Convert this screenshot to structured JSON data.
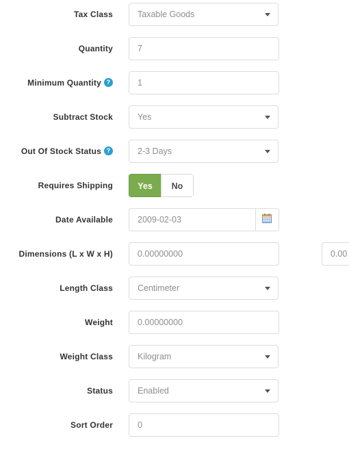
{
  "form": {
    "rows": [
      {
        "label": "Tax Class",
        "help": false,
        "type": "select",
        "value": "Taxable Goods",
        "name": "tax-class"
      },
      {
        "label": "Quantity",
        "help": false,
        "type": "input",
        "value": "7",
        "name": "quantity"
      },
      {
        "label": "Minimum Quantity",
        "help": true,
        "type": "input",
        "value": "1",
        "name": "minimum-quantity"
      },
      {
        "label": "Subtract Stock",
        "help": false,
        "type": "select",
        "value": "Yes",
        "name": "subtract-stock"
      },
      {
        "label": "Out Of Stock Status",
        "help": true,
        "type": "select",
        "value": "2-3 Days",
        "name": "out-of-stock-status"
      },
      {
        "label": "Requires Shipping",
        "help": false,
        "type": "toggle",
        "value": "Yes",
        "options": [
          "Yes",
          "No"
        ],
        "name": "requires-shipping"
      },
      {
        "label": "Date Available",
        "help": false,
        "type": "date",
        "value": "2009-02-03",
        "name": "date-available"
      },
      {
        "label": "Dimensions (L x W x H)",
        "help": false,
        "type": "dimensions",
        "value": "0.00000000",
        "value2": "0.00",
        "name": "dimensions"
      },
      {
        "label": "Length Class",
        "help": false,
        "type": "select",
        "value": "Centimeter",
        "name": "length-class"
      },
      {
        "label": "Weight",
        "help": false,
        "type": "input",
        "value": "0.00000000",
        "name": "weight"
      },
      {
        "label": "Weight Class",
        "help": false,
        "type": "select",
        "value": "Kilogram",
        "name": "weight-class"
      },
      {
        "label": "Status",
        "help": false,
        "type": "select",
        "value": "Enabled",
        "name": "status"
      },
      {
        "label": "Sort Order",
        "help": false,
        "type": "input",
        "value": "0",
        "name": "sort-order"
      }
    ],
    "help_icon_glyph": "?",
    "icons": {
      "help": "help-circle-icon",
      "calendar": "calendar-icon",
      "caret": "chevron-down-icon"
    },
    "colors": {
      "accent_blue": "#2a9fd0",
      "toggle_active_green": "#7aab4d",
      "label_text": "#333333",
      "value_text": "#8e8e93",
      "border": "#dcdcdc"
    }
  }
}
